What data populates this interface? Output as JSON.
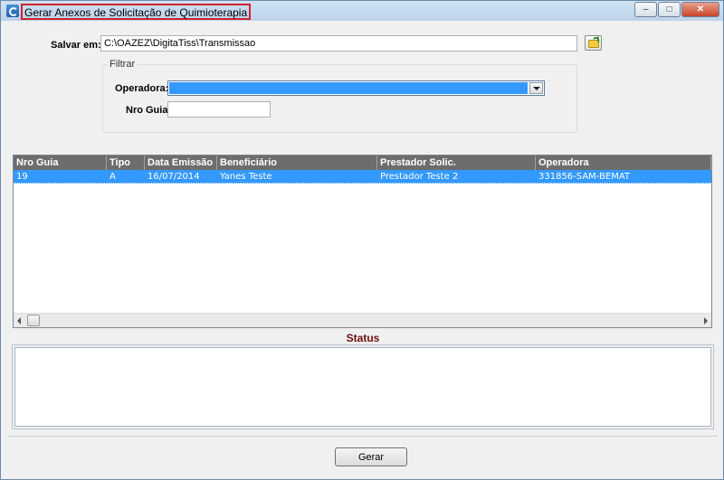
{
  "window": {
    "title": "Gerar Anexos de Solicitação de Quimioterapia",
    "controls": {
      "minimize": "–",
      "maximize": "□",
      "close": "✕"
    }
  },
  "form": {
    "salvar_label": "Salvar em:",
    "salvar_value": "C:\\OAZEZ\\DigitaTiss\\Transmissao",
    "filtrar_legend": "Filtrar",
    "operadora_label": "Operadora:",
    "operadora_value": "",
    "nroguia_label": "Nro Guia:",
    "nroguia_value": ""
  },
  "grid": {
    "columns": [
      "Nro Guia",
      "Tipo",
      "Data Emissão",
      "Beneficiário",
      "Prestador Solic.",
      "Operadora"
    ],
    "rows": [
      [
        "19",
        "A",
        "16/07/2014",
        "Yanes Teste",
        "Prestador Teste 2",
        "331856-SAM-BEMAT"
      ]
    ]
  },
  "status": {
    "title": "Status",
    "text": ""
  },
  "actions": {
    "gerar_label": "Gerar"
  },
  "colors": {
    "selection": "#3399ff",
    "header": "#6d6d6d",
    "status_title": "#6b0f0f",
    "title_highlight": "#d0222a"
  }
}
